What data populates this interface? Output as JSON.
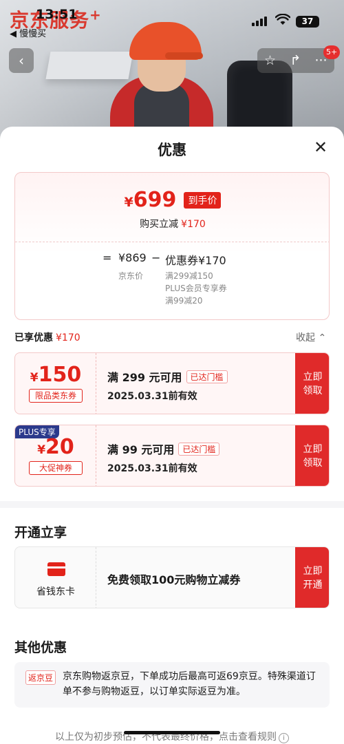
{
  "status_bar": {
    "time": "13:51",
    "back_app": "◀ 慢慢买",
    "battery": "37"
  },
  "hero": {
    "brand": "京东服务",
    "brand_plus": "+",
    "cart_badge": "5+"
  },
  "sheet": {
    "title": "优惠"
  },
  "summary": {
    "final_price_symbol": "¥",
    "final_price": "699",
    "final_tag": "到手价",
    "reduce_label": "购买立减",
    "reduce_value": "¥170",
    "eq": "=",
    "original_price": "¥869",
    "minus": "−",
    "coupon_total": "优惠券¥170",
    "original_label": "京东价",
    "details": [
      "满299减150",
      "PLUS会员专享券",
      "满99减20"
    ]
  },
  "enjoyed": {
    "label": "已享优惠",
    "value": "¥170",
    "collapse": "收起 ⌃"
  },
  "coupons": [
    {
      "symbol": "¥",
      "amount": "150",
      "type": "限品类东券",
      "plus_tag": "",
      "condition": "满 299 元可用",
      "status": "已达门槛",
      "expire": "2025.03.31前有效",
      "claim_line1": "立即",
      "claim_line2": "领取"
    },
    {
      "symbol": "¥",
      "amount": "20",
      "type": "大促神券",
      "plus_tag": "PLUS专享",
      "condition": "满 99 元可用",
      "status": "已达门槛",
      "expire": "2025.03.31前有效",
      "claim_line1": "立即",
      "claim_line2": "领取"
    }
  ],
  "membership": {
    "section_title": "开通立享",
    "name": "省钱东卡",
    "desc": "免费领取100元购物立减券",
    "action_line1": "立即",
    "action_line2": "开通"
  },
  "other": {
    "section_title": "其他优惠",
    "tag": "返京豆",
    "text": "京东购物返京豆，下单成功后最高可返69京豆。特殊渠道订单不参与购物返豆，以订单实际返豆为准。"
  },
  "footer": {
    "note": "以上仅为初步预估，不代表最终价格，点击查看规则"
  },
  "colors": {
    "accent": "#e2231a",
    "plus": "#2b3a8c"
  }
}
